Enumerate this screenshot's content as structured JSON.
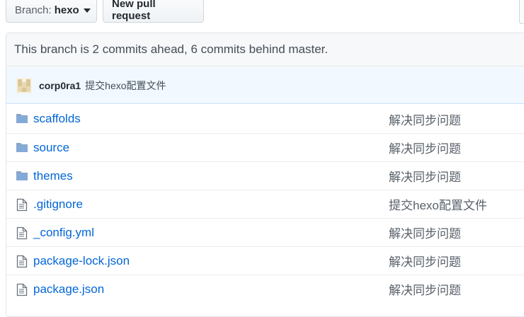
{
  "toolbar": {
    "branch_label": "Branch:",
    "branch_value": "hexo",
    "new_pr_label": "New pull request"
  },
  "branch_info": {
    "text": "This branch is 2 commits ahead, 6 commits behind master."
  },
  "latest_commit": {
    "author": "corp0ra1",
    "message": "提交hexo配置文件"
  },
  "colors": {
    "link": "#0366d6",
    "folder_icon": "#79b8ff",
    "commit_bar_bg": "#f1f8ff"
  },
  "files": [
    {
      "type": "folder",
      "icon": "folder-icon",
      "name": "scaffolds",
      "commit_message": "解决同步问题"
    },
    {
      "type": "folder",
      "icon": "folder-icon",
      "name": "source",
      "commit_message": "解决同步问题"
    },
    {
      "type": "folder",
      "icon": "folder-icon",
      "name": "themes",
      "commit_message": "解决同步问题"
    },
    {
      "type": "file",
      "icon": "file-icon",
      "name": ".gitignore",
      "commit_message": "提交hexo配置文件"
    },
    {
      "type": "file",
      "icon": "file-icon",
      "name": "_config.yml",
      "commit_message": "解决同步问题"
    },
    {
      "type": "file",
      "icon": "file-icon",
      "name": "package-lock.json",
      "commit_message": "解决同步问题"
    },
    {
      "type": "file",
      "icon": "file-icon",
      "name": "package.json",
      "commit_message": "解决同步问题"
    }
  ]
}
